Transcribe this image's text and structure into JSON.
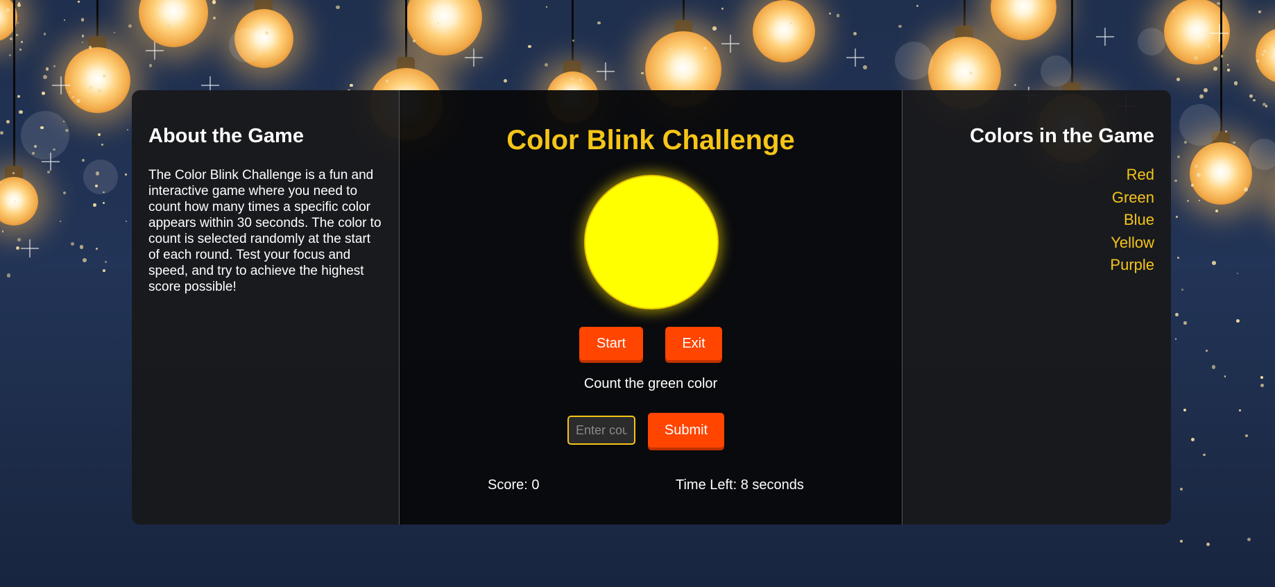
{
  "about": {
    "heading": "About the Game",
    "description": "The Color Blink Challenge is a fun and interactive game where you need to count how many times a specific color appears within 30 seconds. The color to count is selected randomly at the start of each round. Test your focus and speed, and try to achieve the highest score possible!"
  },
  "game": {
    "title": "Color Blink Challenge",
    "circle_color": "#ffff00",
    "start_label": "Start",
    "exit_label": "Exit",
    "prompt": "Count the green color",
    "input_placeholder": "Enter count",
    "submit_label": "Submit",
    "score_text": "Score: 0",
    "time_text": "Time Left: 8 seconds"
  },
  "colors_panel": {
    "heading": "Colors in the Game",
    "items": [
      "Red",
      "Green",
      "Blue",
      "Yellow",
      "Purple"
    ]
  },
  "theme": {
    "accent": "#f5c518",
    "button": "#ff4500"
  }
}
